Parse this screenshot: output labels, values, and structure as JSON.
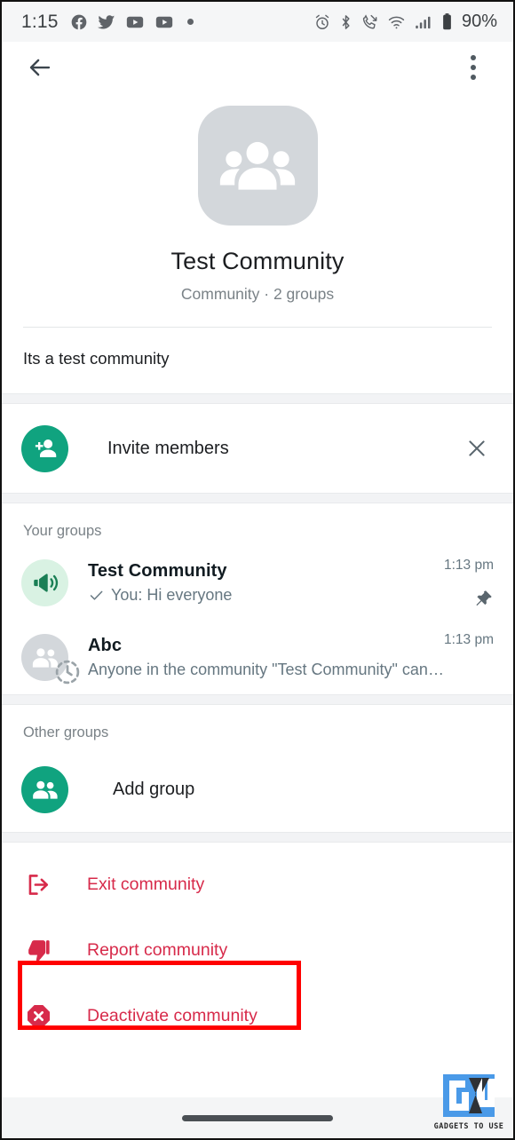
{
  "status_bar": {
    "time": "1:15",
    "battery_percent": "90%",
    "left_icons": [
      "facebook-icon",
      "twitter-icon",
      "youtube-icon",
      "youtube-icon",
      "dot-indicator-icon"
    ],
    "right_icons": [
      "alarm-icon",
      "bluetooth-icon",
      "missed-call-icon",
      "wifi-icon",
      "cellular-signal-icon",
      "battery-icon"
    ]
  },
  "app_bar": {
    "back_icon": "back-arrow-icon",
    "menu_icon": "overflow-menu-icon"
  },
  "profile": {
    "avatar_icon": "community-group-icon",
    "name": "Test Community",
    "subtitle": "Community · 2 groups",
    "description": "Its a test community"
  },
  "invite": {
    "icon": "person-add-icon",
    "label": "Invite members",
    "dismiss_icon": "close-icon"
  },
  "your_groups": {
    "header": "Your groups",
    "items": [
      {
        "avatar_icon": "announcement-megaphone-icon",
        "avatar_style": "lightgreen",
        "name": "Test Community",
        "message": "You: Hi everyone",
        "status_icon": "delivered-check-icon",
        "time": "1:13 pm",
        "badge_icon": "pin-icon",
        "has_disappearing": false
      },
      {
        "avatar_icon": "group-members-icon",
        "avatar_style": "grey",
        "name": "Abc",
        "message": "Anyone in the community \"Test Community\" can request t…",
        "status_icon": "",
        "time": "1:13 pm",
        "badge_icon": "",
        "has_disappearing": true,
        "disappearing_icon": "disappearing-messages-icon"
      }
    ]
  },
  "other_groups": {
    "header": "Other groups",
    "add_group": {
      "icon": "group-add-icon",
      "label": "Add group"
    }
  },
  "danger_actions": [
    {
      "icon": "exit-icon",
      "label": "Exit community",
      "highlighted": false
    },
    {
      "icon": "thumbs-down-icon",
      "label": "Report community",
      "highlighted": false
    },
    {
      "icon": "deactivate-x-icon",
      "label": "Deactivate community",
      "highlighted": true
    }
  ],
  "watermark": {
    "logo_icon": "gadgets-to-use-logo",
    "text": "GADGETS TO USE"
  },
  "nav_bar": {
    "pill_icon": "home-gesture-pill"
  },
  "colors": {
    "brand_green": "#10a37f",
    "light_green": "#d9f2e3",
    "danger_red": "#d72a4a",
    "highlight_red": "#ff0000",
    "text_primary": "#1c1e21",
    "text_secondary": "#667781"
  }
}
